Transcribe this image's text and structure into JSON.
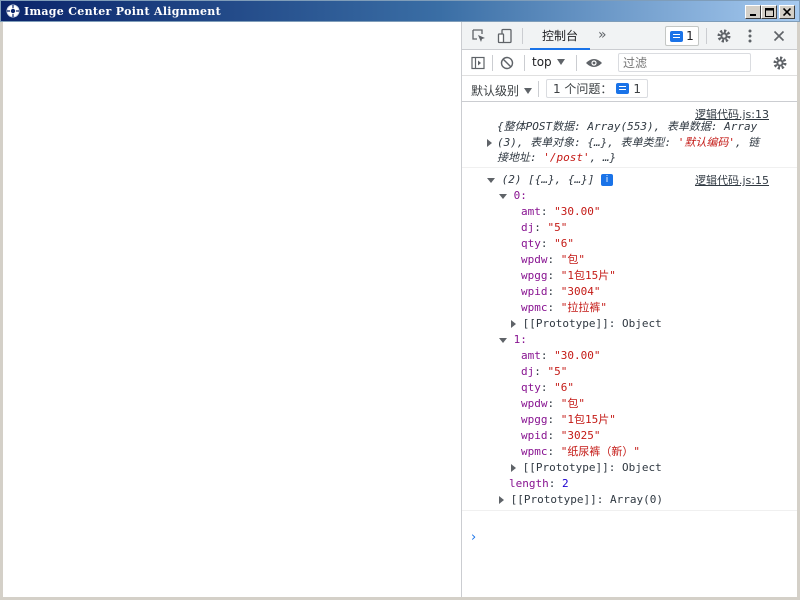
{
  "window": {
    "title": "Image Center Point Alignment"
  },
  "devtools": {
    "tabs": [
      {
        "label": "控制台",
        "active": true
      }
    ],
    "issues_badge_count": "1",
    "context": "top",
    "filter_placeholder": "过滤",
    "level_label": "默认级别",
    "issues_button_label": "1 个问题：",
    "issues_button_count": "1"
  },
  "console": {
    "messages": [
      {
        "source": "逻辑代码.js:13",
        "text_line1": "{整体POST数据: Array(553), 表单数据: Array",
        "text_line2_a": "(3), 表单对象: {…}, 表单类型: ",
        "text_line2_b": "'默认编码'",
        "text_line2_c": ", 链",
        "text_line3_a": "接地址: ",
        "text_line3_b": "'/post'",
        "text_line3_c": ", …}"
      },
      {
        "source": "逻辑代码.js:15",
        "summary": "(2) [{…}, {…}]",
        "info_badge": "i",
        "items": [
          {
            "index": "0:",
            "fields": [
              {
                "key": "amt",
                "value": "\"30.00\""
              },
              {
                "key": "dj",
                "value": "\"5\""
              },
              {
                "key": "qty",
                "value": "\"6\""
              },
              {
                "key": "wpdw",
                "value": "\"包\""
              },
              {
                "key": "wpgg",
                "value": "\"1包15片\""
              },
              {
                "key": "wpid",
                "value": "\"3004\""
              },
              {
                "key": "wpmc",
                "value": "\"拉拉裤\""
              }
            ],
            "prototype": "[[Prototype]]: Object"
          },
          {
            "index": "1:",
            "fields": [
              {
                "key": "amt",
                "value": "\"30.00\""
              },
              {
                "key": "dj",
                "value": "\"5\""
              },
              {
                "key": "qty",
                "value": "\"6\""
              },
              {
                "key": "wpdw",
                "value": "\"包\""
              },
              {
                "key": "wpgg",
                "value": "\"1包15片\""
              },
              {
                "key": "wpid",
                "value": "\"3025\""
              },
              {
                "key": "wpmc",
                "value": "\"纸尿裤（新）\""
              }
            ],
            "prototype": "[[Prototype]]: Object"
          }
        ],
        "length_key": "length",
        "length_value": "2",
        "prototype": "[[Prototype]]: Array(0)"
      }
    ],
    "prompt": "›"
  },
  "colors": {
    "accent": "#1a73e8",
    "key": "#881391",
    "string": "#c41a16",
    "number": "#1c00cf",
    "titlebar": "#0a246a"
  }
}
